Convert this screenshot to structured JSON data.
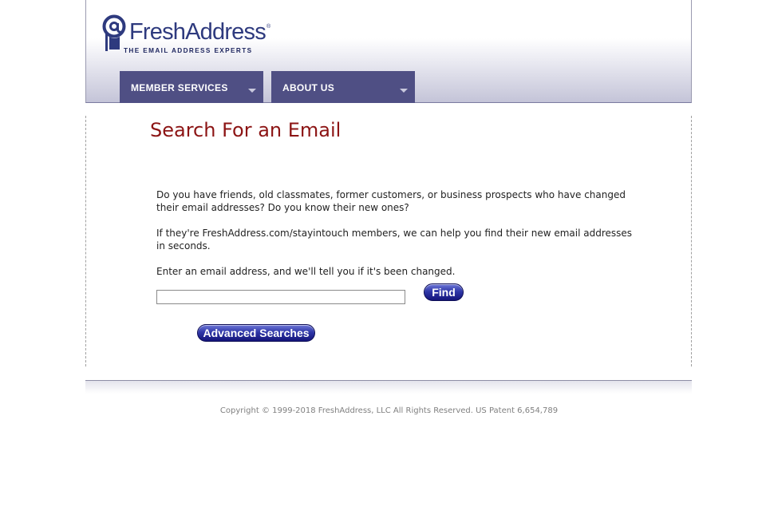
{
  "header": {
    "logo": {
      "name": "FreshAddress",
      "registered": "®",
      "tagline": "THE EMAIL ADDRESS EXPERTS"
    },
    "nav": [
      {
        "label": "MEMBER SERVICES",
        "icon": "chevron-down-icon"
      },
      {
        "label": "ABOUT US",
        "icon": "chevron-down-icon"
      }
    ]
  },
  "main": {
    "title": "Search For an Email",
    "paragraphs": [
      "Do you have friends, old classmates, former customers, or business prospects who have changed their email addresses? Do you know their new ones?",
      "If they're FreshAddress.com/stayintouch members, we can help you find their new email addresses in seconds.",
      "Enter an email address, and we'll tell you if it's been changed."
    ],
    "search_input": {
      "value": "",
      "placeholder": ""
    },
    "find_label": "Find",
    "advanced_label": "Advanced Searches"
  },
  "footer": {
    "copyright": "Copyright © 1999-2018 FreshAddress, LLC All Rights Reserved. US Patent 6,654,789"
  },
  "colors": {
    "nav_background": "#4f4f84",
    "title": "#8c1414",
    "brand": "#2e3a7e",
    "button": "#2f37a8"
  }
}
